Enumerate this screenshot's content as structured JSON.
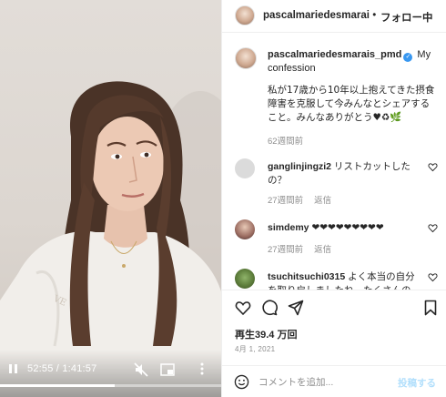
{
  "video": {
    "current_time": "52:55",
    "duration": "1:41:57",
    "time_separator": " / ",
    "progress": 0.52
  },
  "header": {
    "username": "pascalmariedesmarai",
    "separator": " •",
    "follow_label": "フォロー中"
  },
  "caption": {
    "username": "pascalmariedesmarais_pmd",
    "title": " My confession",
    "body": "私が17歳から10年以上抱えてきた摂食障害を克服して今みんなとシェアすること。みんなありがとう♥♻🌿",
    "timestamp": "62週間前"
  },
  "comments": [
    {
      "user": "ganglinjingzi2",
      "text": " リストカットしたの？",
      "time": "27週間前",
      "reply": "返信"
    },
    {
      "user": "simdemy",
      "text": " ❤❤❤❤❤❤❤❤❤",
      "time": "27週間前",
      "reply": "返信"
    },
    {
      "user": "tsuchitsuchi0315",
      "text": " よく本当の自分を取り戻しましたね。たくさんの困難",
      "time": "",
      "reply": ""
    }
  ],
  "stats": {
    "views_label": "再生39.4 万回",
    "date": "4月 1, 2021"
  },
  "add_comment": {
    "placeholder": "コメントを追加...",
    "post_label": "投稿する"
  },
  "colors": {
    "verified": "#3897f0",
    "post_disabled": "#b2dffc",
    "meta_gray": "#8e8e8e"
  }
}
